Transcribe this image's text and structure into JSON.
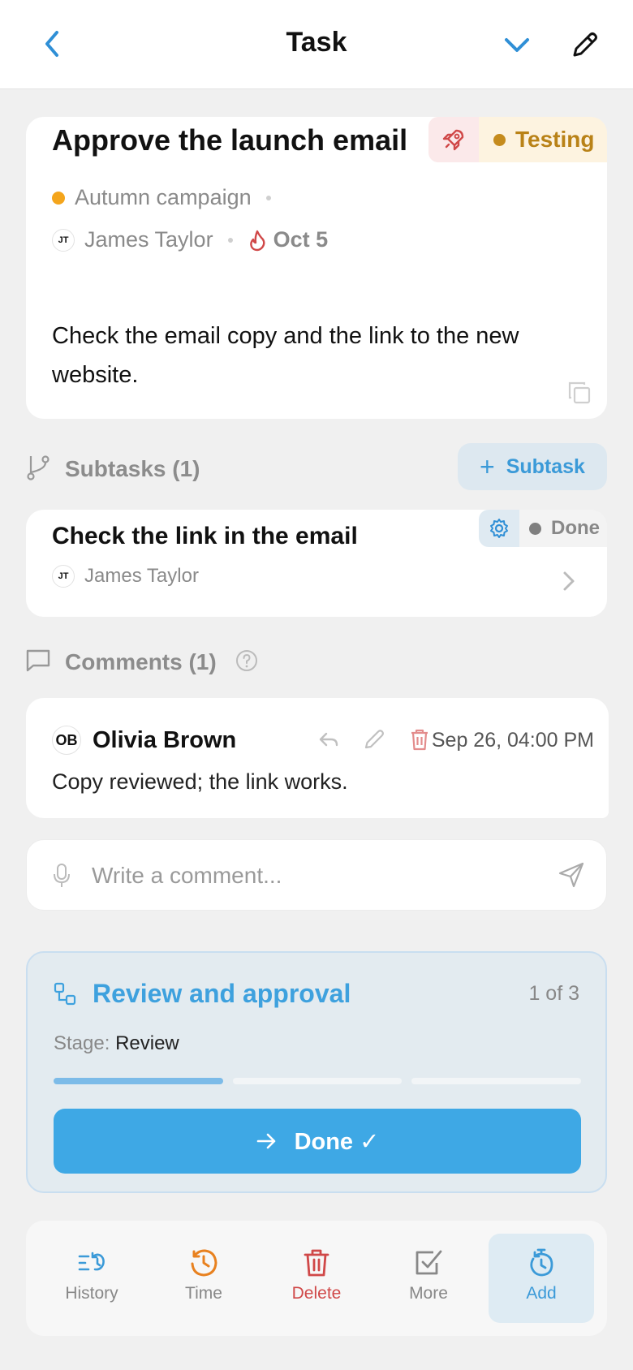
{
  "header": {
    "title": "Task"
  },
  "task": {
    "title": "Approve the launch email",
    "status": "Testing",
    "project": "Autumn campaign",
    "assignee": {
      "initials": "JT",
      "name": "James Taylor"
    },
    "due": "Oct 5",
    "description": "Check the email copy and the link to the new website."
  },
  "subtasks": {
    "title": "Subtasks (1)",
    "add_label": "Subtask",
    "items": [
      {
        "title": "Check the link in the email",
        "status": "Done",
        "assignee_initials": "JT",
        "assignee_name": "James Taylor"
      }
    ]
  },
  "comments": {
    "title": "Comments (1)",
    "items": [
      {
        "author_initials": "OB",
        "author": "Olivia Brown",
        "time": "Sep 26, 04:00 PM",
        "text": "Copy reviewed; the link works."
      }
    ],
    "placeholder": "Write a comment..."
  },
  "workflow": {
    "title": "Review and approval",
    "count": "1 of 3",
    "stage_label": "Stage:",
    "stage_value": "Review",
    "progress": {
      "completed": 1,
      "total": 3
    },
    "button_label": "Done ✓"
  },
  "bottom_nav": {
    "history": "History",
    "time": "Time",
    "delete": "Delete",
    "more": "More",
    "add": "Add"
  },
  "colors": {
    "accent": "#3ea8e5",
    "status_testing": "#b98217",
    "danger": "#d04848",
    "time_orange": "#e8811f"
  }
}
